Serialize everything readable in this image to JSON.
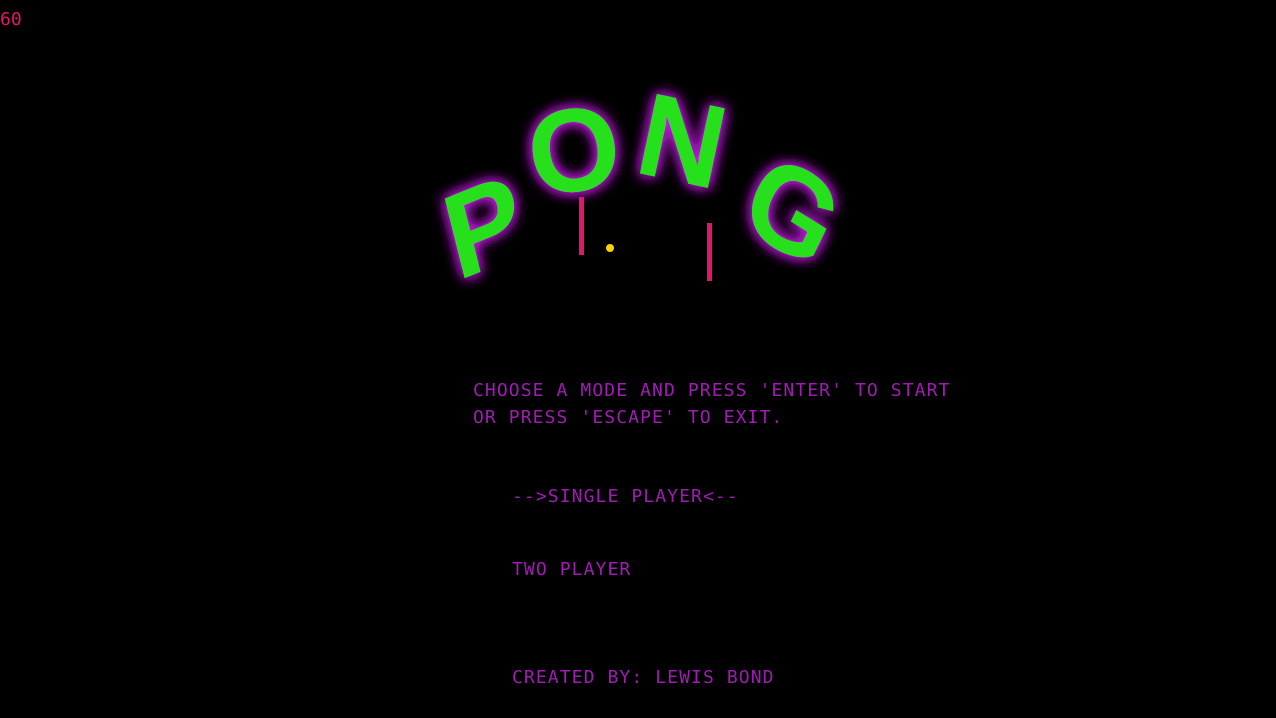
{
  "hud": {
    "fps": "60"
  },
  "logo": {
    "letters": [
      "P",
      "O",
      "N",
      "G"
    ],
    "color": "#26e01a",
    "glow_color": "#c21fe0"
  },
  "demo": {
    "paddle_color": "#e0176a",
    "ball_color": "#ffd400"
  },
  "menu": {
    "instruction_line_1": "CHOOSE A MODE AND PRESS 'ENTER' TO START",
    "instruction_line_2": "OR PRESS 'ESCAPE' TO EXIT.",
    "options": [
      {
        "label": "-->SINGLE PLAYER<--",
        "selected": true
      },
      {
        "label": "TWO PLAYER",
        "selected": false
      }
    ],
    "text_color": "#a11bb4"
  },
  "credits": {
    "text": "CREATED BY: LEWIS BOND"
  }
}
